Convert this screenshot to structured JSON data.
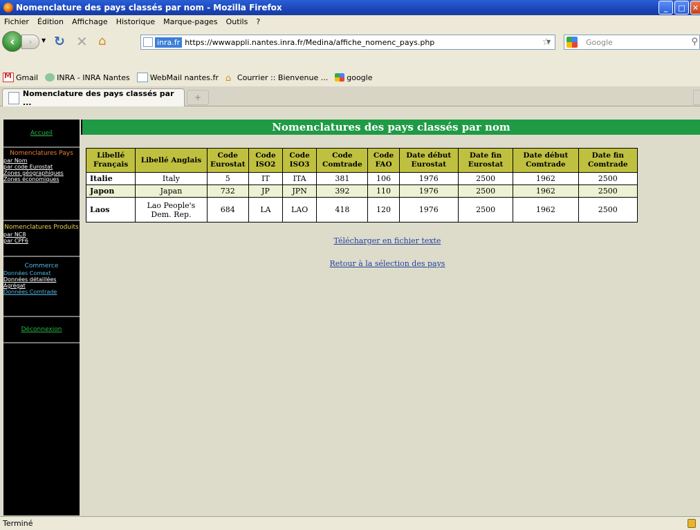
{
  "window": {
    "title": "Nomenclature des pays classés par nom - Mozilla Firefox"
  },
  "menu": [
    "Fichier",
    "Édition",
    "Affichage",
    "Historique",
    "Marque-pages",
    "Outils",
    "?"
  ],
  "nav": {
    "identity": "inra.fr",
    "url": "https://wwwappli.nantes.inra.fr/Medina/affiche_nomenc_pays.php",
    "search_placeholder": "Google"
  },
  "bookmarks": [
    "Gmail",
    "INRA - INRA Nantes",
    "WebMail nantes.fr",
    "Courrier :: Bienvenue ...",
    "google"
  ],
  "tab": {
    "label": "Nomenclature des pays classés par ...",
    "new_tab": "+"
  },
  "sidebar": {
    "accueil": "Accueil",
    "pays_title": "Nomenclatures Pays",
    "pays_links": [
      "par Nom",
      "par code Eurostat",
      "Zones géographiques",
      "Zones économiques"
    ],
    "produits_title": "Nomenclatures Produits",
    "produits_links": [
      "par NC8",
      "par CPF6"
    ],
    "commerce_title": "Commerce",
    "commerce_links": [
      "Données Comext",
      "Données détaillées",
      "Agrégat",
      "Données Comtrade"
    ],
    "deconnexion": "Déconnexion"
  },
  "main": {
    "banner": "Nomenclatures des pays classés par nom",
    "headers": [
      "Libellé Français",
      "Libellé Anglais",
      "Code Eurostat",
      "Code ISO2",
      "Code ISO3",
      "Code Comtrade",
      "Code FAO",
      "Date début Eurostat",
      "Date fin Eurostat",
      "Date début Comtrade",
      "Date fin Comtrade"
    ],
    "rows": [
      [
        "Italie",
        "Italy",
        "5",
        "IT",
        "ITA",
        "381",
        "106",
        "1976",
        "2500",
        "1962",
        "2500"
      ],
      [
        "Japon",
        "Japan",
        "732",
        "JP",
        "JPN",
        "392",
        "110",
        "1976",
        "2500",
        "1962",
        "2500"
      ],
      [
        "Laos",
        "Lao People's Dem. Rep.",
        "684",
        "LA",
        "LAO",
        "418",
        "120",
        "1976",
        "2500",
        "1962",
        "2500"
      ]
    ],
    "download_link": "Télécharger en fichier texte",
    "back_link": "Retour à la sélection des pays"
  },
  "status": {
    "text": "Terminé"
  }
}
